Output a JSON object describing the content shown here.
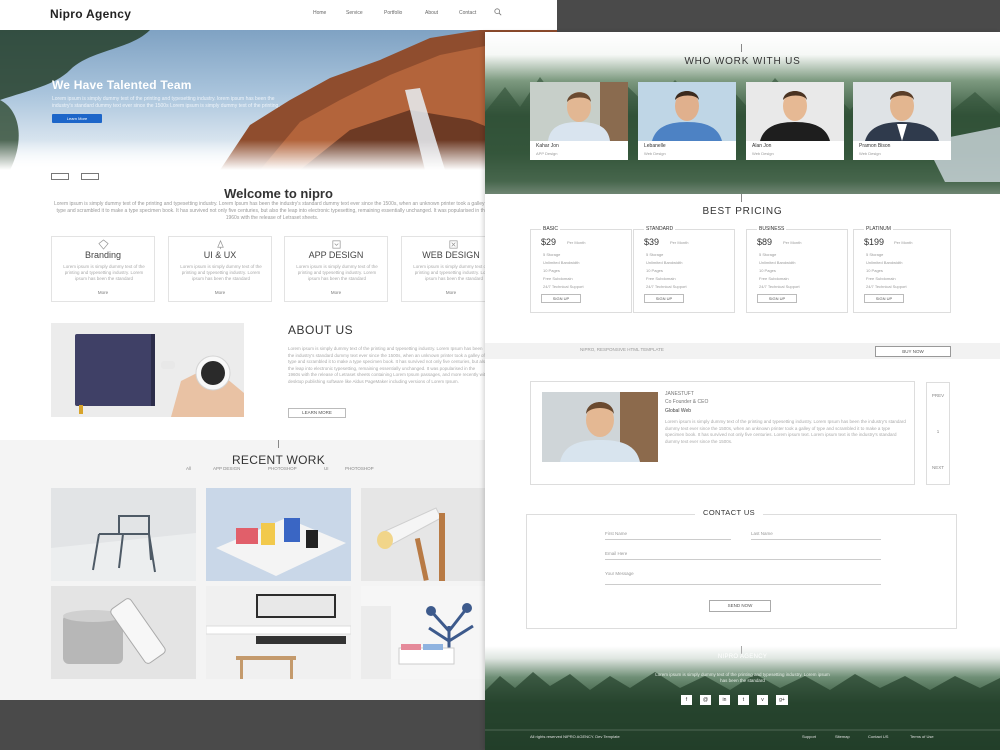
{
  "site": {
    "brand": "Nipro Agency"
  },
  "nav": {
    "links": [
      "Home",
      "Service",
      "Portfolio",
      "About",
      "Contact"
    ]
  },
  "hero": {
    "title": "We Have Talented Team",
    "text": "Lorem ipsum is simply dummy text of the printing and typesetting industry. lorem ipsum has been the industry's standard dummy text ever since the 1500s Lorem ipsum is simply dummy text of the printing.",
    "button": "Learn More"
  },
  "welcome": {
    "title": "Welcome to nipro",
    "text": "Lorem ipsum is simply dummy text of the printing and typesetting industry. Lorem Ipsum has been the industry's standard dummy text ever since the 1500s, when an unknown printer took a galley of type and scrambled it to make a type specimen book. It has survived not only five centuries, but also the leap into electronic typesetting, remaining essentially unchanged. It was popularised in the 1960s with the release of Letraset sheets."
  },
  "services": [
    {
      "title": "Branding",
      "icon": "branding-icon",
      "desc": "Lorem ipsum is simply dummy text of the printing and typesetting industry. Lorem ipsum has been the standard",
      "more": "More"
    },
    {
      "title": "UI & UX",
      "icon": "ui-ux-icon",
      "desc": "Lorem ipsum is simply dummy text of the printing and typesetting industry. Lorem ipsum has been the standard",
      "more": "More"
    },
    {
      "title": "APP DESIGN",
      "icon": "app-design-icon",
      "desc": "Lorem ipsum is simply dummy text of the printing and typesetting industry. Lorem ipsum has been the standard",
      "more": "More"
    },
    {
      "title": "WEB DESIGN",
      "icon": "web-design-icon",
      "desc": "Lorem ipsum is simply dummy text of the printing and typesetting industry. Lorem ipsum has been the standard",
      "more": "More"
    }
  ],
  "about": {
    "title": "ABOUT US",
    "text": "Lorem ipsum is simply dummy text of the printing and typesetting industry. Lorem Ipsum has been the industry's standard dummy text ever since the 1500s, when an unknown printer took a galley of type and scrambled it to make a type specimen book. It has survived not only five centuries, but also the leap into electronic typesetting, remaining essentially unchanged. It was popularised in the 1960s with the release of Letraset sheets containing Lorem Ipsum passages, and more recently with desktop publishing software like Aldus PageMaker including versions of Lorem Ipsum.",
    "button": "LEARN MORE"
  },
  "recent": {
    "title": "RECENT WORK",
    "filters": [
      "All",
      "APP DESIGN",
      "PHOTOSHOP",
      "UI",
      "PHOTOSHOP"
    ]
  },
  "team": {
    "title": "WHO WORK WITH US",
    "members": [
      {
        "name": "Kahar Jon",
        "role": "APP Design"
      },
      {
        "name": "Lebanelle",
        "role": "Web Design"
      },
      {
        "name": "Alan Jon",
        "role": "Web Design"
      },
      {
        "name": "Pramon Bison",
        "role": "Web Design"
      }
    ]
  },
  "pricing": {
    "title": "BEST PRICING",
    "plans": [
      {
        "name": "BASIC",
        "price": "$29",
        "per": "Per Month",
        "features": [
          "5 Storage",
          "Unlimited Bandwidth",
          "10 Pages",
          "Free Subdomain",
          "24/7 Technical Support"
        ],
        "button": "SIGN UP"
      },
      {
        "name": "STANDARD",
        "price": "$39",
        "per": "Per Month",
        "features": [
          "5 Storage",
          "Unlimited Bandwidth",
          "10 Pages",
          "Free Subdomain",
          "24/7 Technical Support"
        ],
        "button": "SIGN UP"
      },
      {
        "name": "BUSINESS",
        "price": "$89",
        "per": "Per Month",
        "features": [
          "5 Storage",
          "Unlimited Bandwidth",
          "10 Pages",
          "Free Subdomain",
          "24/7 Technical Support"
        ],
        "button": "SIGN UP"
      },
      {
        "name": "PLATINUM",
        "price": "$199",
        "per": "Per Month",
        "features": [
          "5 Storage",
          "Unlimited Bandwidth",
          "10 Pages",
          "Free Subdomain",
          "24/7 Technical Support"
        ],
        "button": "SIGN UP"
      }
    ]
  },
  "cta": {
    "text": "NIPRO, RESPONSIVE HTML TEMPLATE",
    "button": "BUY NOW"
  },
  "testimonial": {
    "quote": "JANESTUFT",
    "name": "Co Founder & CEO",
    "role": "Global Web",
    "text": "Lorem ipsum is simply dummy text of the printing and typesetting industry. Lorem Ipsum has been the industry's standard dummy text ever since the 1500s, when an unknown printer took a galley of type and scrambled it to make a type specimen book. It has survived not only five centuries. Lorem ipsum text. Lorem ipsum text is the industry's standard dummy text ever since the 1500s.",
    "nav": [
      "PREV",
      "1",
      "NEXT"
    ]
  },
  "contact": {
    "title": "CONTACT US",
    "fields": {
      "first": "First Name",
      "last": "Last Name",
      "email": "Email Here",
      "message": "Your Message"
    },
    "button": "SEND NOW"
  },
  "footer": {
    "title": "NIPRO AGENCY",
    "text": "Lorem ipsum is simply dummy text of the printing and typesetting industry. Lorem ipsum has been the standard",
    "social": [
      "f",
      "@",
      "in",
      "t",
      "v",
      "g+"
    ],
    "copyright": "All rights reserved NIPRO AGENCY. Dev Template",
    "links": [
      "Support",
      "Sitemap",
      "Contact US",
      "Terms of Use"
    ]
  }
}
